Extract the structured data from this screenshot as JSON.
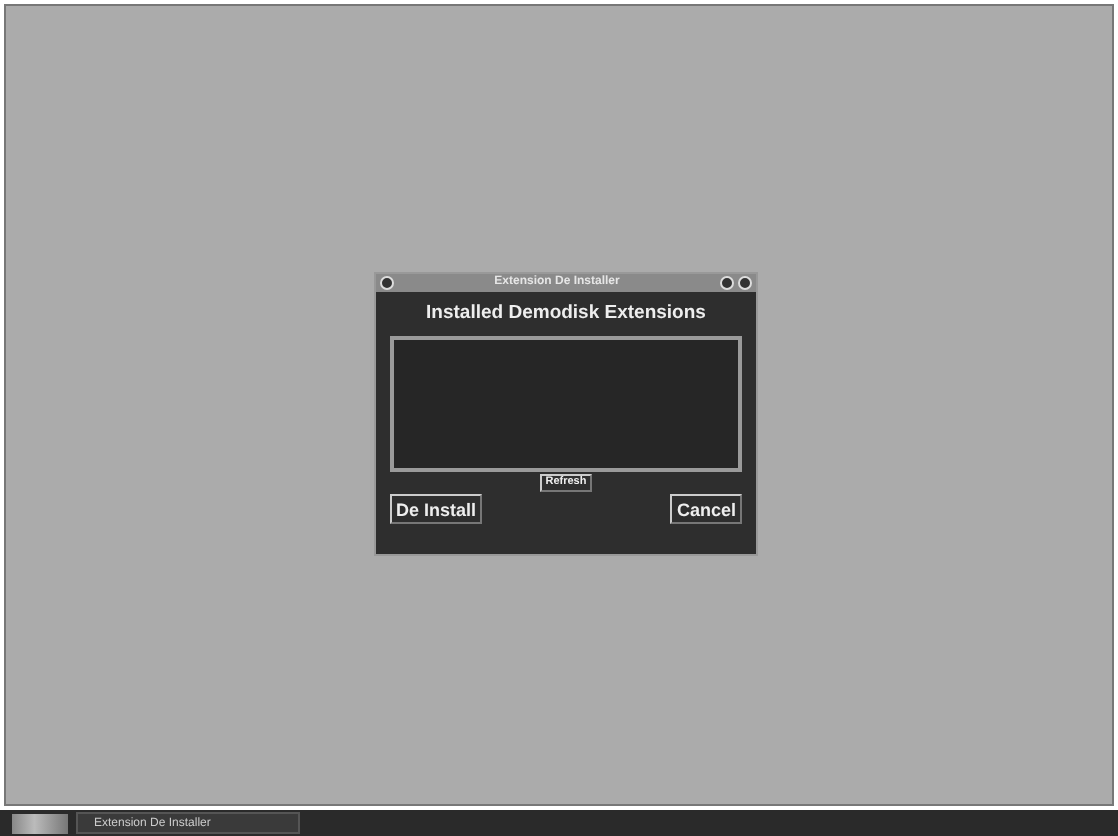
{
  "window": {
    "title": "Extension De Installer"
  },
  "heading": "Installed Demodisk Extensions",
  "buttons": [
    {
      "kind": "small",
      "label": "Refresh"
    },
    {
      "kind": "main",
      "label": "De Install"
    },
    {
      "kind": "main",
      "label": "Cancel"
    }
  ],
  "taskbar": {
    "items": [
      {
        "label": "Extension De Installer",
        "selected": true
      }
    ]
  }
}
